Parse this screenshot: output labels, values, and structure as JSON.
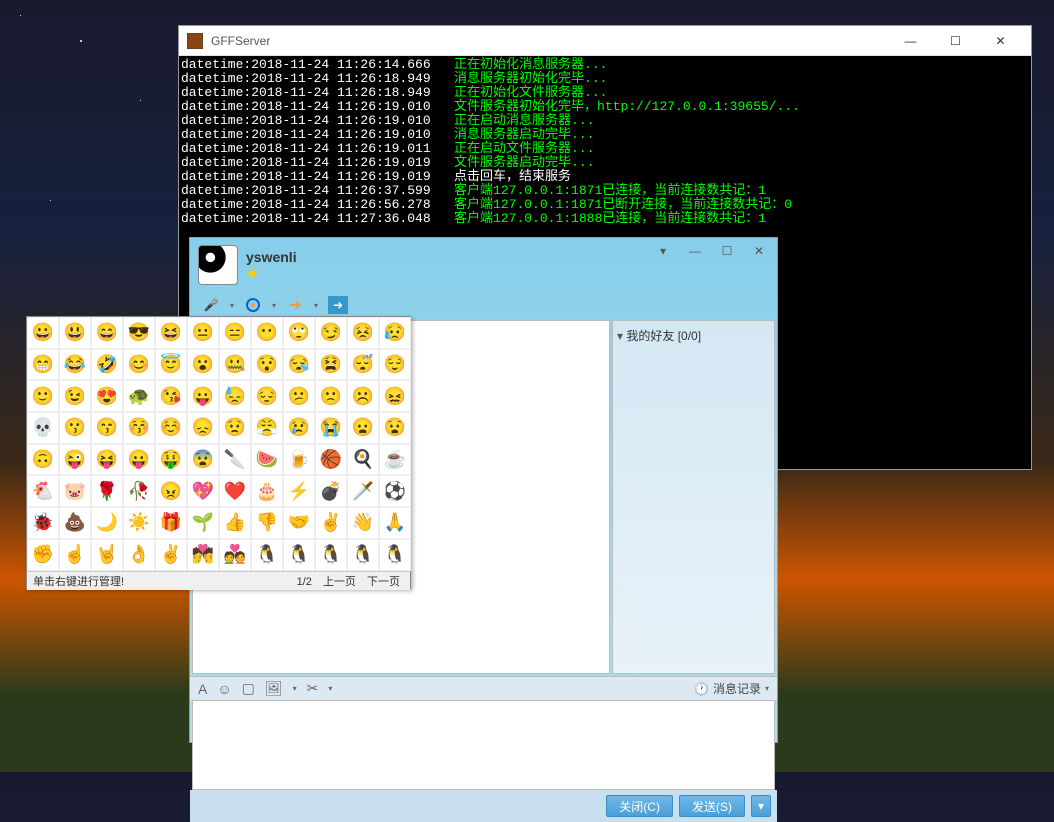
{
  "console": {
    "title": "GFFServer",
    "logs": [
      {
        "dt": "datetime:2018-11-24 11:26:14.666",
        "msg": "   正在初始化消息服务器..."
      },
      {
        "dt": "datetime:2018-11-24 11:26:18.949",
        "msg": "   消息服务器初始化完毕..."
      },
      {
        "dt": "datetime:2018-11-24 11:26:18.949",
        "msg": "   正在初始化文件服务器..."
      },
      {
        "dt": "datetime:2018-11-24 11:26:19.010",
        "msg": "   文件服务器初始化完毕，http://127.0.0.1:39655/..."
      },
      {
        "dt": "datetime:2018-11-24 11:26:19.010",
        "msg": "   正在启动消息服务器..."
      },
      {
        "dt": "datetime:2018-11-24 11:26:19.010",
        "msg": "   消息服务器启动完毕..."
      },
      {
        "dt": "datetime:2018-11-24 11:26:19.011",
        "msg": "   正在启动文件服务器..."
      },
      {
        "dt": "datetime:2018-11-24 11:26:19.019",
        "msg": "   文件服务器启动完毕..."
      },
      {
        "dt": "datetime:2018-11-24 11:26:19.019",
        "msg": "   点击回车，结束服务",
        "white": true
      },
      {
        "dt": "datetime:2018-11-24 11:26:37.599",
        "msg": "   客户端127.0.0.1:1871已连接，当前连接数共记：1"
      },
      {
        "dt": "datetime:2018-11-24 11:26:56.278",
        "msg": "   客户端127.0.0.1:1871已断开连接，当前连接数共记：0"
      },
      {
        "dt": "datetime:2018-11-24 11:27:36.048",
        "msg": "   客户端127.0.0.1:1888已连接，当前连接数共记：1"
      }
    ]
  },
  "chat": {
    "username": "yswenli",
    "friend_group_label": "我的好友   [0/0]",
    "msg_history_label": "消息记录",
    "close_btn": "关闭(C)",
    "send_btn": "发送(S)"
  },
  "emoji": {
    "footer_hint": "单击右键进行管理!",
    "page_indicator": "1/2",
    "prev_label": "上一页",
    "next_label": "下一页",
    "left_grid": [
      "😀",
      "😃",
      "😄",
      "😎",
      "😆",
      "😁",
      "😂",
      "🤣",
      "😊",
      "😇",
      "🙂",
      "😉",
      "😍",
      "🐢",
      "😘",
      "💀",
      "😗",
      "😙",
      "😚",
      "☺️",
      "🙃",
      "😜",
      "😝",
      "😛",
      "🤑",
      "🐔",
      "🐷",
      "🌹",
      "🥀",
      "😠",
      "🐞",
      "💩",
      "🌙",
      "☀️",
      "🎁",
      "✊",
      "☝️",
      "🤘",
      "👌",
      "✌️"
    ],
    "right_grid": [
      "😐",
      "😑",
      "😶",
      "🙄",
      "😏",
      "😣",
      "😥",
      "😮",
      "🤐",
      "😯",
      "😪",
      "😫",
      "😴",
      "😌",
      "😛",
      "😓",
      "😔",
      "😕",
      "🙁",
      "☹️",
      "😖",
      "😞",
      "😟",
      "😤",
      "😢",
      "😭",
      "😦",
      "😧",
      "😨",
      "🔪",
      "🍉",
      "🍺",
      "🏀",
      "🍳",
      "☕",
      "💖",
      "❤️",
      "🎂",
      "⚡",
      "💣",
      "🗡️",
      "⚽",
      "🌱",
      "👍",
      "👎",
      "🤝",
      "✌️",
      "👋",
      "🙏",
      "💏",
      "💑",
      "🐧",
      "🐧",
      "🐧",
      "🐧",
      "🐧"
    ]
  }
}
